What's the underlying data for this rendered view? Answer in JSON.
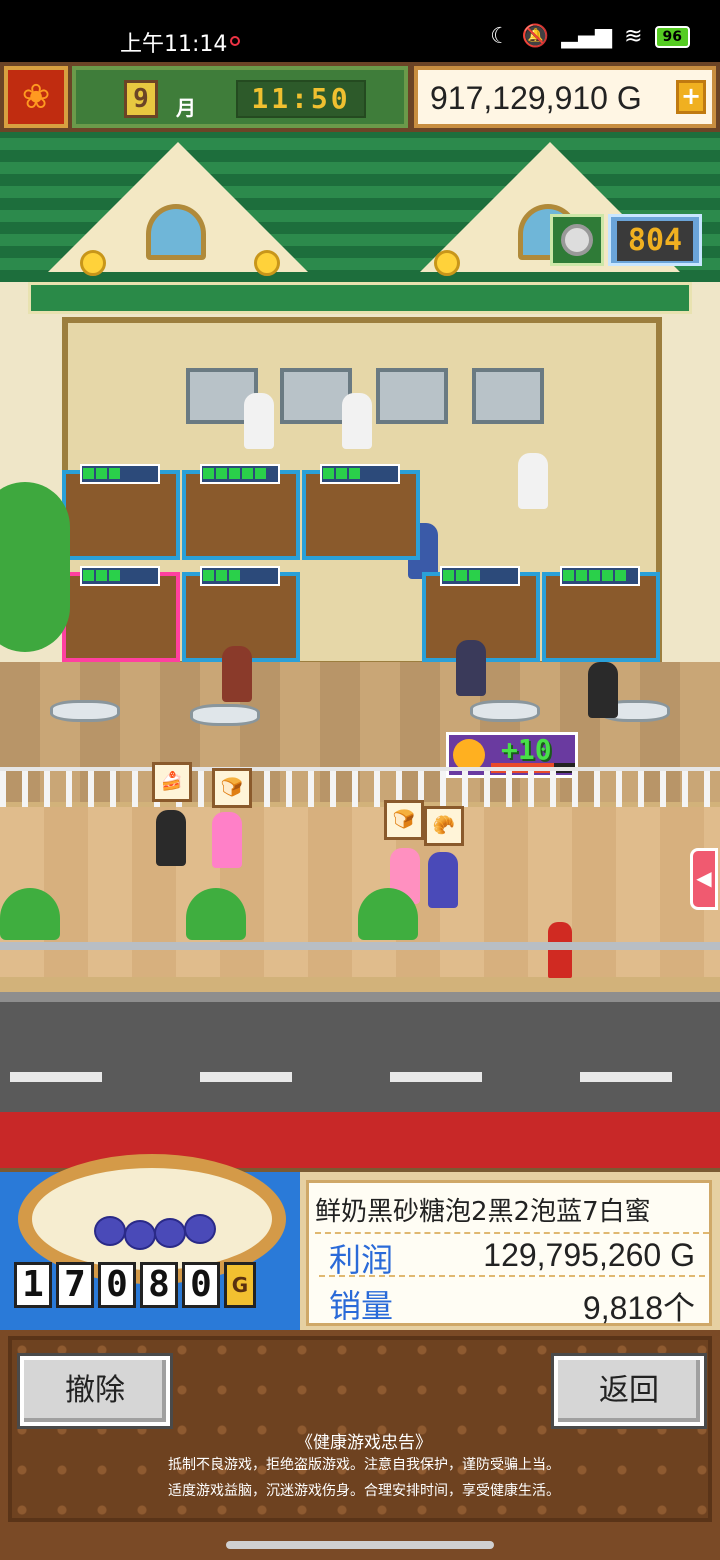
{
  "status_bar": {
    "time": "上午11:14",
    "battery": "96"
  },
  "hud": {
    "month": "9",
    "month_unit": "月",
    "clock": "11:50",
    "money": "917,129,910 G",
    "add_label": "+"
  },
  "scene": {
    "counter": "804",
    "popularity_gain": "+10",
    "popularity_fill": 0.75
  },
  "product": {
    "price_digits": [
      "1",
      "7",
      "0",
      "8",
      "0"
    ],
    "price_unit": "G",
    "name": "鲜奶黑砂糖泡2黑2泡蓝7白蜜",
    "profit_label": "利润",
    "profit_value": "129,795,260 G",
    "sales_label": "销量",
    "sales_value": "9,818个"
  },
  "buttons": {
    "remove": "撤除",
    "back": "返回"
  },
  "notice": {
    "title": "《健康游戏忠告》",
    "line1": "抵制不良游戏，拒绝盗版游戏。注意自我保护，谨防受骗上当。",
    "line2": "适度游戏益脑，沉迷游戏伤身。合理安排时间，享受健康生活。"
  },
  "colors": {
    "accent_green": "#3f7d3a",
    "money_border": "#c88e40",
    "stat_label_blue": "#2a6ad8"
  }
}
